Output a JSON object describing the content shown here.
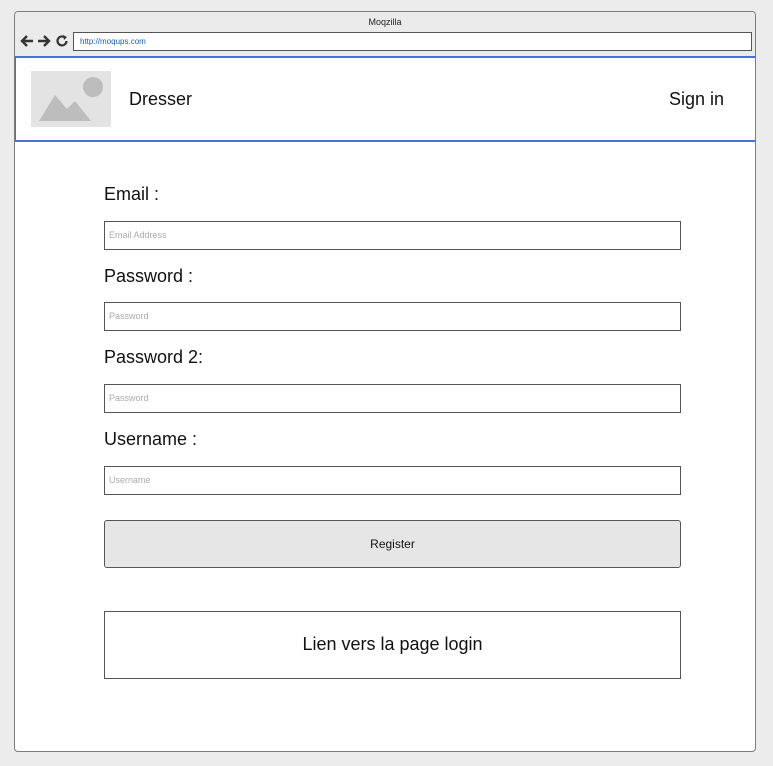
{
  "browser": {
    "title": "Moqzilla",
    "url": "http://moqups.com"
  },
  "header": {
    "brand": "Dresser",
    "signin_label": "Sign in"
  },
  "form": {
    "email": {
      "label": "Email :",
      "placeholder": "Email Address"
    },
    "password": {
      "label": "Password :",
      "placeholder": "Password"
    },
    "password2": {
      "label": "Password 2:",
      "placeholder": "Password"
    },
    "username": {
      "label": "Username :",
      "placeholder": "Username"
    },
    "register_label": "Register",
    "login_link_label": "Lien vers la page login"
  },
  "colors": {
    "header_border": "#4a6fd8",
    "url_text": "#1a5fb4",
    "button_bg": "#e6e6e6",
    "page_bg": "#ececec"
  }
}
